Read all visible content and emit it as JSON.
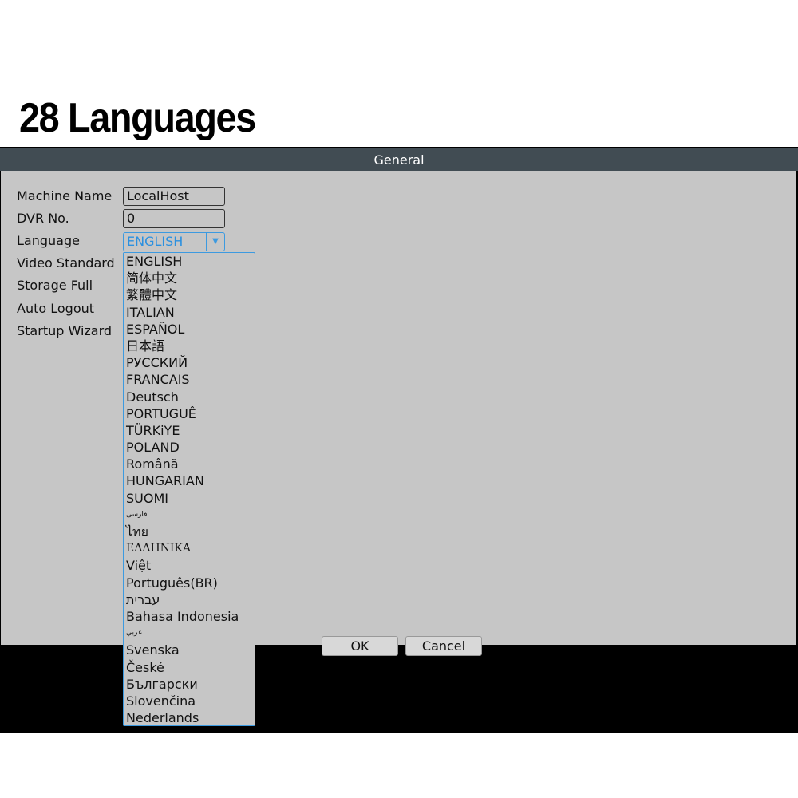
{
  "headline": "28 Languages",
  "dialog": {
    "title": "General",
    "labels": [
      "Machine Name",
      "DVR No.",
      "Language",
      "Video Standard",
      "Storage Full",
      "Auto Logout",
      "Startup Wizard"
    ],
    "machine_name": "LocalHost",
    "dvr_no": "0",
    "language": "ENGLISH",
    "ok_label": "OK",
    "cancel_label": "Cancel"
  },
  "language_options": [
    "ENGLISH",
    "简体中文",
    "繁體中文",
    "ITALIAN",
    "ESPAÑOL",
    "日本語",
    "РУССКИЙ",
    "FRANCAIS",
    "Deutsch",
    "PORTUGUÊ",
    "TÜRKiYE",
    "POLAND",
    "Română",
    "HUNGARIAN",
    "SUOMI",
    "فارسی",
    "ไทย",
    "ΕΛΛΗΝΙΚΑ",
    "Việt",
    "Português(BR)",
    "עברית",
    "Bahasa Indonesia",
    "عربي",
    "Svenska",
    "České",
    "Български",
    "Slovenčina",
    "Nederlands"
  ],
  "colors": {
    "titlebar": "#414c53",
    "panel": "#c6c6c6",
    "accent": "#3c9ae0"
  },
  "icons": {
    "dropdown": "triangle-down-icon"
  }
}
